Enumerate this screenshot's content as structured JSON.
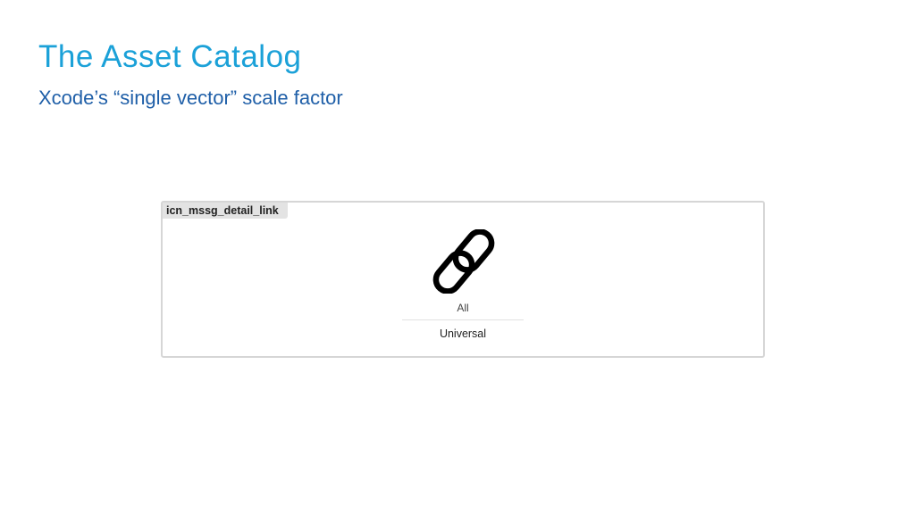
{
  "slide": {
    "title": "The Asset Catalog",
    "subtitle": "Xcode’s “single vector” scale factor"
  },
  "asset": {
    "name": "icn_mssg_detail_link",
    "icon": "link-icon",
    "slot_label": "All",
    "idiom_label": "Universal"
  },
  "colors": {
    "title": "#1ba1d8",
    "subtitle": "#1f5fa8",
    "panel_border": "#d6d6d6",
    "name_tab_background": "#e3e3e3"
  }
}
